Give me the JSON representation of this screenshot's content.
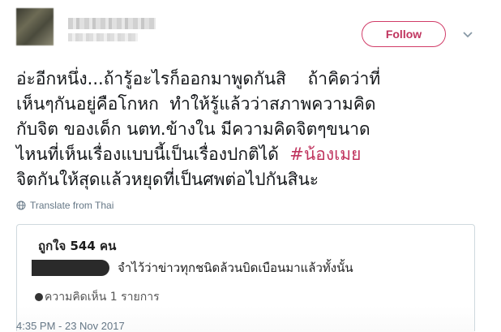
{
  "header": {
    "follow_label": "Follow"
  },
  "tweet": {
    "text_lines": [
      "อ่ะอีกหนึ่ง...ถ้ารู้อะไรก็ออกมาพูดกันสิ    ถ้าคิดว่าที่",
      "เห็นๆกันอยู่คือโกหก  ทำให้รู้แล้วว่าสภาพความคิด",
      "กับจิต ของเด็ก นตท.ข้างใน มีความคิดจิตๆขนาด",
      "ไหนที่เห็นเรื่องแบบนี้เป็นเรื่องปกติได้  "
    ],
    "hashtag": "#น้องเมย",
    "last_line": "จิตกันให้สุดแล้วหยุดที่เป็นศพต่อไปกันสินะ",
    "translate_label": "Translate from Thai",
    "timestamp": "4:35 PM - 23 Nov 2017"
  },
  "embedded_card": {
    "likes": "ถูกใจ 544 คน",
    "comment_text": "จำไว้ว่าข่าวทุกชนิดล้วนบิดเบือนมาแล้วทั้งนั้น",
    "comments_count": "ความคิดเห็น 1 รายการ"
  },
  "colors": {
    "accent": "#c0355f",
    "text": "#14171a",
    "muted": "#657786",
    "border": "#cfd9de"
  }
}
